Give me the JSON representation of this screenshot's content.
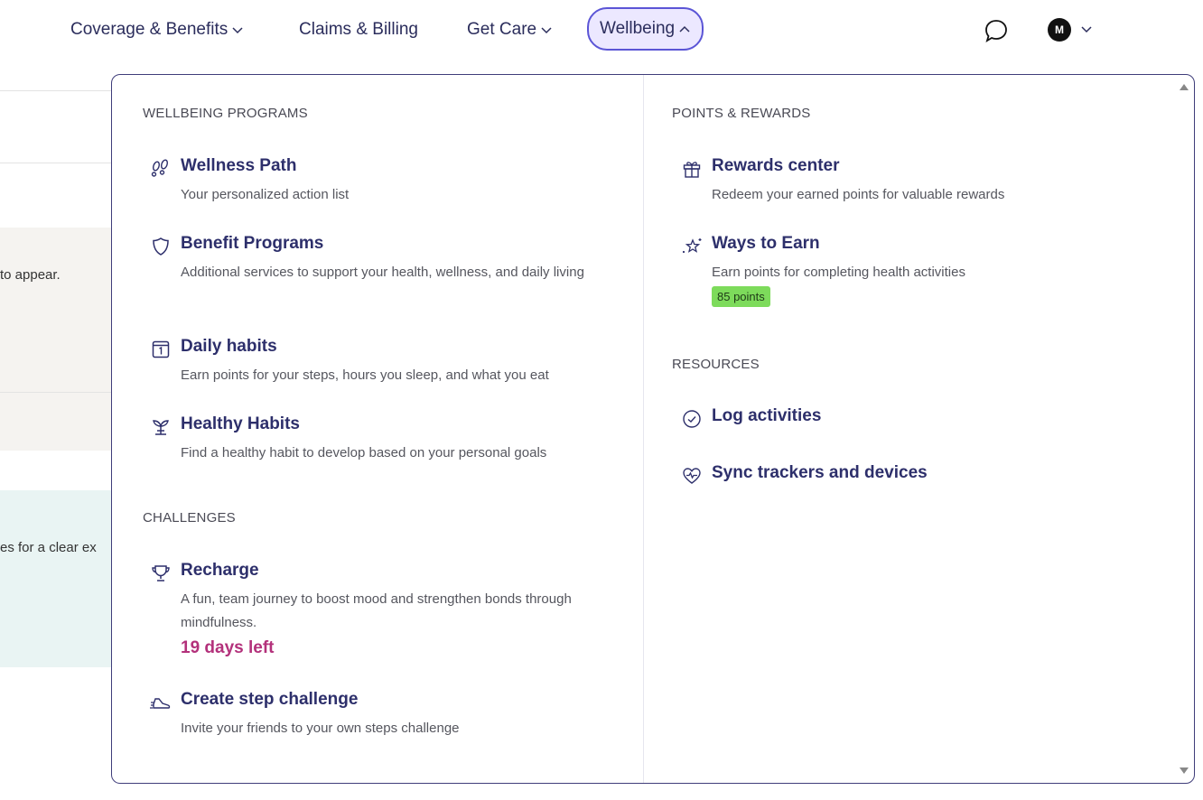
{
  "nav": {
    "items": [
      {
        "label": "Coverage & Benefits"
      },
      {
        "label": "Claims & Billing"
      },
      {
        "label": "Get Care"
      },
      {
        "label": "Wellbeing"
      }
    ],
    "avatar_initial": "M"
  },
  "background": {
    "fragment1": "to appear.",
    "fragment2": "es for a clear ex"
  },
  "panel": {
    "programs": {
      "title": "WELLBEING PROGRAMS",
      "items": [
        {
          "title": "Wellness Path",
          "desc": "Your personalized action list",
          "icon": "footprints-icon"
        },
        {
          "title": "Benefit Programs",
          "desc": "Additional services to support your health, wellness, and daily living",
          "icon": "shield-icon"
        },
        {
          "title": "Daily habits",
          "desc": "Earn points for your steps, hours you sleep, and what you eat",
          "icon": "calendar-icon"
        },
        {
          "title": "Healthy Habits",
          "desc": "Find a healthy habit to develop based on your personal goals",
          "icon": "plant-icon"
        }
      ]
    },
    "challenges": {
      "title": "CHALLENGES",
      "items": [
        {
          "title": "Recharge",
          "desc": "A fun, team journey to boost mood and strengthen bonds through mindfulness.",
          "status": "19 days left",
          "icon": "trophy-icon"
        },
        {
          "title": "Create step challenge",
          "desc": "Invite your friends to your own steps challenge",
          "icon": "shoe-icon"
        }
      ]
    },
    "rewards": {
      "title": "POINTS & REWARDS",
      "items": [
        {
          "title": "Rewards center",
          "desc": "Redeem your earned points for valuable rewards",
          "icon": "gift-icon"
        },
        {
          "title": "Ways to Earn",
          "desc": "Earn points for completing health activities",
          "badge": "85 points",
          "icon": "sparkle-star-icon"
        }
      ]
    },
    "resources": {
      "title": "RESOURCES",
      "items": [
        {
          "title": "Log activities",
          "icon": "check-circle-icon"
        },
        {
          "title": "Sync trackers and devices",
          "icon": "heart-pulse-icon"
        }
      ]
    }
  },
  "colors": {
    "accent": "#5b55d6",
    "text": "#2d2f6b",
    "countdown": "#b3317b",
    "badge": "#7ddb5b"
  }
}
